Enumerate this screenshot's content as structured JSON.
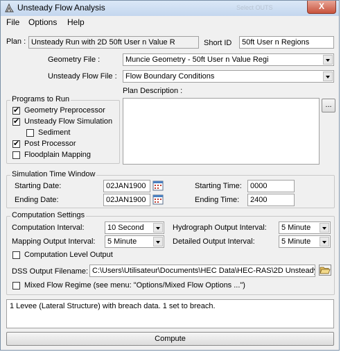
{
  "window": {
    "title": "Unsteady Flow Analysis",
    "ghost_text": "Select OUTS",
    "close_glyph": "X"
  },
  "menu": [
    "File",
    "Options",
    "Help"
  ],
  "plan": {
    "label": "Plan :",
    "value": "Unsteady Run with 2D 50ft User n Value R",
    "short_id_label": "Short ID",
    "short_id_value": "50ft User n Regions"
  },
  "geometry": {
    "label": "Geometry File :",
    "value": "Muncie Geometry - 50ft User n Value Regi"
  },
  "unsteady": {
    "label": "Unsteady Flow File :",
    "value": "Flow Boundary Conditions"
  },
  "description": {
    "label": "Plan Description :",
    "value": "",
    "button": "..."
  },
  "programs": {
    "legend": "Programs to Run",
    "items": [
      {
        "label": "Geometry Preprocessor",
        "checked": true
      },
      {
        "label": "Unsteady Flow Simulation",
        "checked": true
      },
      {
        "label": "Sediment",
        "checked": false
      },
      {
        "label": "Post Processor",
        "checked": true
      },
      {
        "label": "Floodplain Mapping",
        "checked": false
      }
    ]
  },
  "time": {
    "legend": "Simulation Time Window",
    "start_date_label": "Starting Date:",
    "start_date": "02JAN1900",
    "end_date_label": "Ending Date:",
    "end_date": "02JAN1900",
    "start_time_label": "Starting Time:",
    "start_time": "0000",
    "end_time_label": "Ending Time:",
    "end_time": "2400"
  },
  "computation": {
    "legend": "Computation Settings",
    "interval_label": "Computation Interval:",
    "interval": "10 Second",
    "hydro_label": "Hydrograph Output Interval:",
    "hydro": "5 Minute",
    "mapping_label": "Mapping Output Interval:",
    "mapping": "5 Minute",
    "detailed_label": "Detailed Output Interval:",
    "detailed": "5 Minute",
    "level_output_label": "Computation Level Output",
    "level_output_checked": false,
    "dss_label": "DSS Output Filename:",
    "dss_value": "C:\\Users\\Utilisateur\\Documents\\HEC Data\\HEC-RAS\\2D Unsteady I",
    "mixed_label": "Mixed Flow Regime (see menu:  \"Options/Mixed Flow Options ...\")",
    "mixed_checked": false
  },
  "messages": "1 Levee (Lateral Structure) with breach data.  1 set to breach.",
  "compute_button": "Compute"
}
